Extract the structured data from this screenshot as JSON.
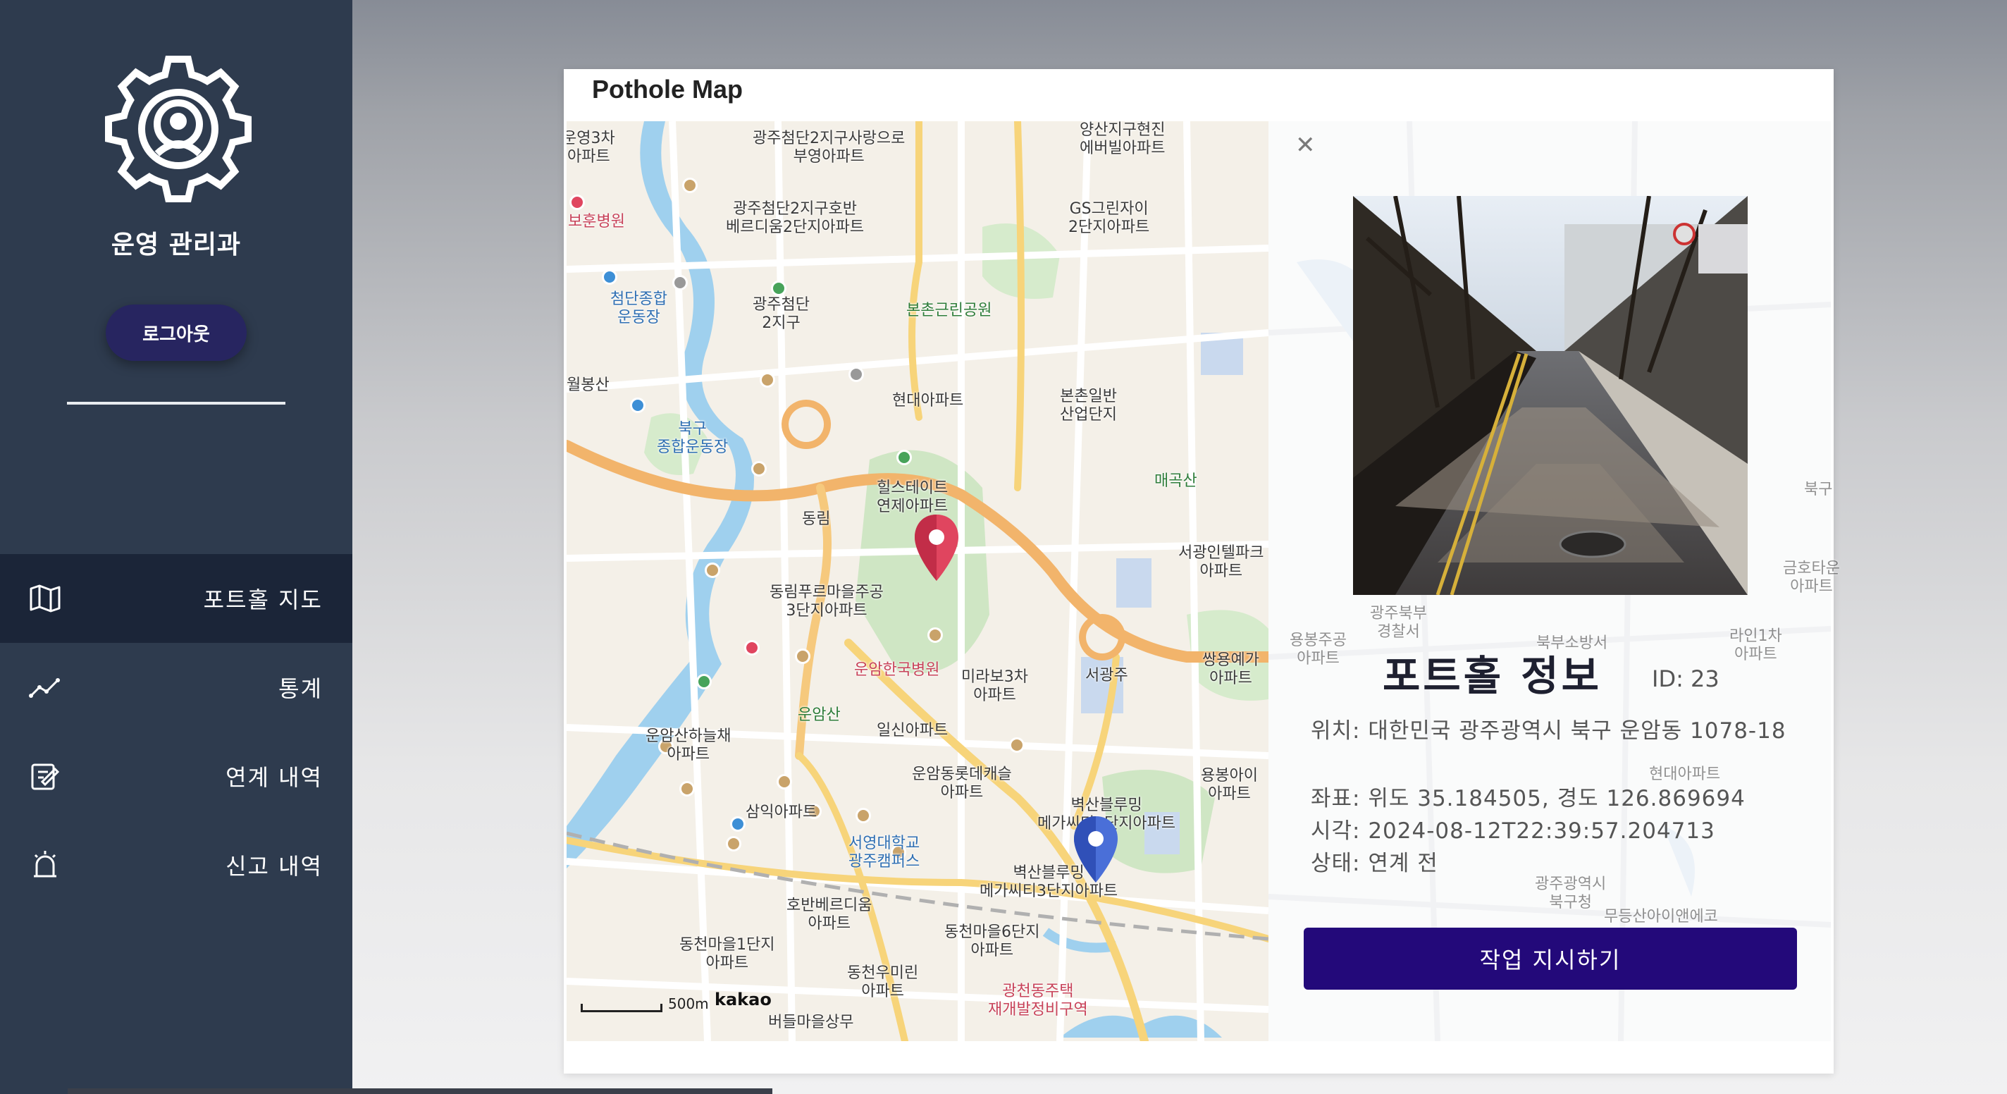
{
  "sidebar": {
    "org_name": "운영 관리과",
    "logout_label": "로그아웃",
    "logo_icon": "gear-shield-icon",
    "nav": [
      {
        "label": "포트홀 지도",
        "icon": "map-icon",
        "active": true
      },
      {
        "label": "통계",
        "icon": "chart-line-icon",
        "active": false
      },
      {
        "label": "연계 내역",
        "icon": "edit-icon",
        "active": false
      },
      {
        "label": "신고 내역",
        "icon": "alarm-icon",
        "active": false
      }
    ]
  },
  "panel": {
    "title": "Pothole Map"
  },
  "map": {
    "provider": "kakao",
    "scale_label": "500m",
    "labels": {
      "l1": "광주첨단2지구사랑으로\n부영아파트",
      "l2": "양산지구현진\n에버빌아파트",
      "l3": "광주첨단2지구호반\n베르디움2단지아파트",
      "l4": "GS그린자이\n2단지아파트",
      "l5": "첨단종합\n운동장",
      "l6": "광주첨단\n2지구",
      "l7": "본촌근린공원",
      "l8": "현대아파트",
      "l9": "본촌일반\n산업단지",
      "l10": "북구\n종합운동장",
      "l11": "매곡산",
      "l12": "힐스테이트\n연제아파트",
      "l13": "동림",
      "l14": "서광인텔파크\n아파트",
      "l15": "동림푸르마을주공\n3단지아파트",
      "l16": "운암한국병원",
      "l17": "미라보3차\n아파트",
      "l18": "서광주",
      "l19": "쌍용예가\n아파트",
      "l20": "운암산",
      "l21": "일신아파트",
      "l22": "운암산하늘채\n아파트",
      "l23": "운암동롯데캐슬\n아파트",
      "l24": "용봉아이\n아파트",
      "l25": "삼익아파트",
      "l26": "벽산블루밍\n메가씨티1단지아파트",
      "l27": "서영대학교\n광주캠퍼스",
      "l28": "벽산블루밍\n메가씨티3단지아파트",
      "l29": "호반베르디움\n아파트",
      "l30": "동천마을6단지\n아파트",
      "l31": "동천마을1단지\n아파트",
      "l32": "동천우미린\n아파트",
      "l33": "광천동주택\n재개발정비구역",
      "l34": "버들마을상무",
      "l35": "보훈병원",
      "l36": "월봉산",
      "l37": "운영3차\n아파트",
      "l38": "북구",
      "l39": "금호타운\n아파트",
      "l40": "라인1차\n아파트",
      "l41": "광주광역시\n북구청",
      "l42": "현대아파트",
      "l43": "무등산아이앤에코",
      "l44": "광주북부\n경찰서",
      "l45": "북부소방서",
      "l46": "용봉주공\n아파트"
    }
  },
  "info": {
    "title": "포트홀 정보",
    "id_label": "ID: 23",
    "location": "위치: 대한민국 광주광역시 북구 운암동 1078-18",
    "coords": "좌표: 위도 35.184505, 경도 126.869694",
    "time": "시각: 2024-08-12T22:39:57.204713",
    "status": "상태: 연계 전",
    "action_label": "작업 지시하기",
    "close_icon": "close-icon"
  },
  "colors": {
    "sidebar_bg": "#2e3b4e",
    "sidebar_active": "#1b2538",
    "logout_bg": "#272560",
    "action_bg": "#23097a",
    "marker_red": "#e0455f",
    "marker_blue": "#4a6fd8"
  }
}
